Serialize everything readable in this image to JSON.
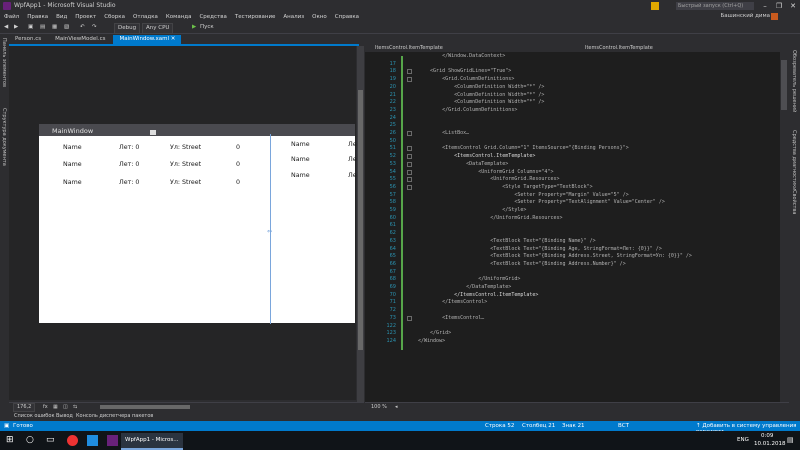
{
  "window": {
    "title": "WpfApp1 - Microsoft Visual Studio",
    "controls": [
      "–",
      "❐",
      "✕"
    ]
  },
  "quick_launch": {
    "placeholder": "Быстрый запуск (Ctrl+Q)"
  },
  "menu": [
    "Файл",
    "Правка",
    "Вид",
    "Проект",
    "Сборка",
    "Отладка",
    "Команда",
    "Средства",
    "Тестирование",
    "Анализ",
    "Окно",
    "Справка"
  ],
  "user": {
    "name": "Башинский дима"
  },
  "toolbar": {
    "config": "Debug",
    "platform": "Any CPU",
    "start_label": "Пуск"
  },
  "left_rail": [
    "Панель элементов",
    "Структура документа"
  ],
  "right_rail": [
    "Обозреватель решений",
    "Средства диагностики",
    "Свойства"
  ],
  "tabs": [
    {
      "label": "Person.cs",
      "active": false
    },
    {
      "label": "MainViewModel.cs",
      "active": false
    },
    {
      "label": "MainWindow.xaml",
      "active": true
    }
  ],
  "designer": {
    "window_title": "MainWindow",
    "rows": [
      [
        "Name",
        "Лет: 0",
        "Ул: Street",
        "0"
      ],
      [
        "Name",
        "Лет: 0",
        "Ул: Street",
        "0"
      ],
      [
        "Name",
        "Лет: 0",
        "Ул: Street",
        "0"
      ]
    ],
    "right_rows": [
      [
        "Name",
        "Ле"
      ],
      [
        "Name",
        "Ле"
      ],
      [
        "Name",
        "Ле"
      ]
    ],
    "zoom": "176,2"
  },
  "editor": {
    "tab_left": "ItemsControl.ItemTemplate",
    "tab_right": "ItemsControl.ItemTemplate",
    "lines": [
      {
        "n": "",
        "code": "        </Window.DataContext>"
      },
      {
        "n": "17",
        "code": ""
      },
      {
        "n": "18",
        "code": "    <Grid ShowGridLines=\"True\">"
      },
      {
        "n": "19",
        "code": "        <Grid.ColumnDefinitions>"
      },
      {
        "n": "20",
        "code": "            <ColumnDefinition Width=\"*\" />"
      },
      {
        "n": "21",
        "code": "            <ColumnDefinition Width=\"*\" />"
      },
      {
        "n": "22",
        "code": "            <ColumnDefinition Width=\"*\" />"
      },
      {
        "n": "23",
        "code": "        </Grid.ColumnDefinitions>"
      },
      {
        "n": "24",
        "code": ""
      },
      {
        "n": "25",
        "code": ""
      },
      {
        "n": "26",
        "code": "        <ListBox…"
      },
      {
        "n": "50",
        "code": ""
      },
      {
        "n": "51",
        "code": "        <ItemsControl Grid.Column=\"1\" ItemsSource=\"{Binding Persons}\">"
      },
      {
        "n": "52",
        "code": "            <ItemsControl.ItemTemplate>"
      },
      {
        "n": "53",
        "code": "                <DataTemplate>"
      },
      {
        "n": "54",
        "code": "                    <UniformGrid Columns=\"4\">"
      },
      {
        "n": "55",
        "code": "                        <UniformGrid.Resources>"
      },
      {
        "n": "56",
        "code": "                            <Style TargetType=\"TextBlock\">"
      },
      {
        "n": "57",
        "code": "                                <Setter Property=\"Margin\" Value=\"5\" />"
      },
      {
        "n": "58",
        "code": "                                <Setter Property=\"TextAlignment\" Value=\"Center\" />"
      },
      {
        "n": "59",
        "code": "                            </Style>"
      },
      {
        "n": "60",
        "code": "                        </UniformGrid.Resources>"
      },
      {
        "n": "61",
        "code": ""
      },
      {
        "n": "62",
        "code": ""
      },
      {
        "n": "63",
        "code": "                        <TextBlock Text=\"{Binding Name}\" />"
      },
      {
        "n": "64",
        "code": "                        <TextBlock Text=\"{Binding Age, StringFormat=Лет: {0}}\" />"
      },
      {
        "n": "65",
        "code": "                        <TextBlock Text=\"{Binding Address.Street, StringFormat=Ул: {0}}\" />"
      },
      {
        "n": "66",
        "code": "                        <TextBlock Text=\"{Binding Address.Number}\" />"
      },
      {
        "n": "67",
        "code": ""
      },
      {
        "n": "68",
        "code": "                    </UniformGrid>"
      },
      {
        "n": "69",
        "code": "                </DataTemplate>"
      },
      {
        "n": "70",
        "code": "            </ItemsControl.ItemTemplate>"
      },
      {
        "n": "71",
        "code": "        </ItemsControl>"
      },
      {
        "n": "72",
        "code": ""
      },
      {
        "n": "73",
        "code": "        <ItemsControl…"
      },
      {
        "n": "122",
        "code": ""
      },
      {
        "n": "123",
        "code": "    </Grid>"
      },
      {
        "n": "124",
        "code": "</Window>"
      }
    ],
    "zoom": "100 %",
    "row": "Строка 52",
    "col": "Столбец 21",
    "char": "Знак 21",
    "mode": "ВСТ"
  },
  "bottom_tabs": [
    "Список ошибок",
    "Вывод",
    "Консоль диспетчера пакетов"
  ],
  "status": {
    "ready": "Готово",
    "source_control": "↑ Добавить в систему управления версиями"
  },
  "taskbar": {
    "app_label": "WpfApp1 - Micros...",
    "lang": "ENG",
    "time": "0:09",
    "date": "10.01.2018"
  }
}
